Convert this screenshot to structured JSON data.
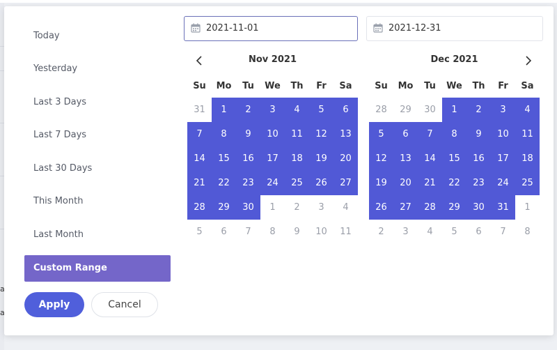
{
  "background": {
    "fragment_a": "a",
    "fragment_b": "a."
  },
  "ranges": [
    {
      "label": "Today"
    },
    {
      "label": "Yesterday"
    },
    {
      "label": "Last 3 Days"
    },
    {
      "label": "Last 7 Days"
    },
    {
      "label": "Last 30 Days"
    },
    {
      "label": "This Month"
    },
    {
      "label": "Last Month"
    },
    {
      "label": "Custom Range",
      "active": true
    }
  ],
  "buttons": {
    "apply": "Apply",
    "cancel": "Cancel"
  },
  "inputs": {
    "start": "2021-11-01",
    "end": "2021-12-31"
  },
  "weekdays": [
    "Su",
    "Mo",
    "Tu",
    "We",
    "Th",
    "Fr",
    "Sa"
  ],
  "calendars": [
    {
      "title": "Nov 2021",
      "weeks": [
        [
          "31",
          "1",
          "2",
          "3",
          "4",
          "5",
          "6"
        ],
        [
          "7",
          "8",
          "9",
          "10",
          "11",
          "12",
          "13"
        ],
        [
          "14",
          "15",
          "16",
          "17",
          "18",
          "19",
          "20"
        ],
        [
          "21",
          "22",
          "23",
          "24",
          "25",
          "26",
          "27"
        ],
        [
          "28",
          "29",
          "30",
          "1",
          "2",
          "3",
          "4"
        ],
        [
          "5",
          "6",
          "7",
          "8",
          "9",
          "10",
          "11"
        ]
      ],
      "off": [
        [
          0,
          0
        ],
        [
          4,
          3
        ],
        [
          4,
          4
        ],
        [
          4,
          5
        ],
        [
          4,
          6
        ],
        [
          5,
          0
        ],
        [
          5,
          1
        ],
        [
          5,
          2
        ],
        [
          5,
          3
        ],
        [
          5,
          4
        ],
        [
          5,
          5
        ],
        [
          5,
          6
        ]
      ],
      "selected": [
        [
          0,
          1
        ],
        [
          0,
          2
        ],
        [
          0,
          3
        ],
        [
          0,
          4
        ],
        [
          0,
          5
        ],
        [
          0,
          6
        ],
        [
          1,
          0
        ],
        [
          1,
          1
        ],
        [
          1,
          2
        ],
        [
          1,
          3
        ],
        [
          1,
          4
        ],
        [
          1,
          5
        ],
        [
          1,
          6
        ],
        [
          2,
          0
        ],
        [
          2,
          1
        ],
        [
          2,
          2
        ],
        [
          2,
          3
        ],
        [
          2,
          4
        ],
        [
          2,
          5
        ],
        [
          2,
          6
        ],
        [
          3,
          0
        ],
        [
          3,
          1
        ],
        [
          3,
          2
        ],
        [
          3,
          3
        ],
        [
          3,
          4
        ],
        [
          3,
          5
        ],
        [
          3,
          6
        ],
        [
          4,
          0
        ],
        [
          4,
          1
        ],
        [
          4,
          2
        ]
      ]
    },
    {
      "title": "Dec 2021",
      "weeks": [
        [
          "28",
          "29",
          "30",
          "1",
          "2",
          "3",
          "4"
        ],
        [
          "5",
          "6",
          "7",
          "8",
          "9",
          "10",
          "11"
        ],
        [
          "12",
          "13",
          "14",
          "15",
          "16",
          "17",
          "18"
        ],
        [
          "19",
          "20",
          "21",
          "22",
          "23",
          "24",
          "25"
        ],
        [
          "26",
          "27",
          "28",
          "29",
          "30",
          "31",
          "1"
        ],
        [
          "2",
          "3",
          "4",
          "5",
          "6",
          "7",
          "8"
        ]
      ],
      "off": [
        [
          0,
          0
        ],
        [
          0,
          1
        ],
        [
          0,
          2
        ],
        [
          4,
          6
        ],
        [
          5,
          0
        ],
        [
          5,
          1
        ],
        [
          5,
          2
        ],
        [
          5,
          3
        ],
        [
          5,
          4
        ],
        [
          5,
          5
        ],
        [
          5,
          6
        ]
      ],
      "selected": [
        [
          0,
          3
        ],
        [
          0,
          4
        ],
        [
          0,
          5
        ],
        [
          0,
          6
        ],
        [
          1,
          0
        ],
        [
          1,
          1
        ],
        [
          1,
          2
        ],
        [
          1,
          3
        ],
        [
          1,
          4
        ],
        [
          1,
          5
        ],
        [
          1,
          6
        ],
        [
          2,
          0
        ],
        [
          2,
          1
        ],
        [
          2,
          2
        ],
        [
          2,
          3
        ],
        [
          2,
          4
        ],
        [
          2,
          5
        ],
        [
          2,
          6
        ],
        [
          3,
          0
        ],
        [
          3,
          1
        ],
        [
          3,
          2
        ],
        [
          3,
          3
        ],
        [
          3,
          4
        ],
        [
          3,
          5
        ],
        [
          3,
          6
        ],
        [
          4,
          0
        ],
        [
          4,
          1
        ],
        [
          4,
          2
        ],
        [
          4,
          3
        ],
        [
          4,
          4
        ],
        [
          4,
          5
        ]
      ]
    }
  ],
  "colors": {
    "selected": "#5159d6",
    "active_range": "#7466c9",
    "apply": "#505fdb"
  }
}
